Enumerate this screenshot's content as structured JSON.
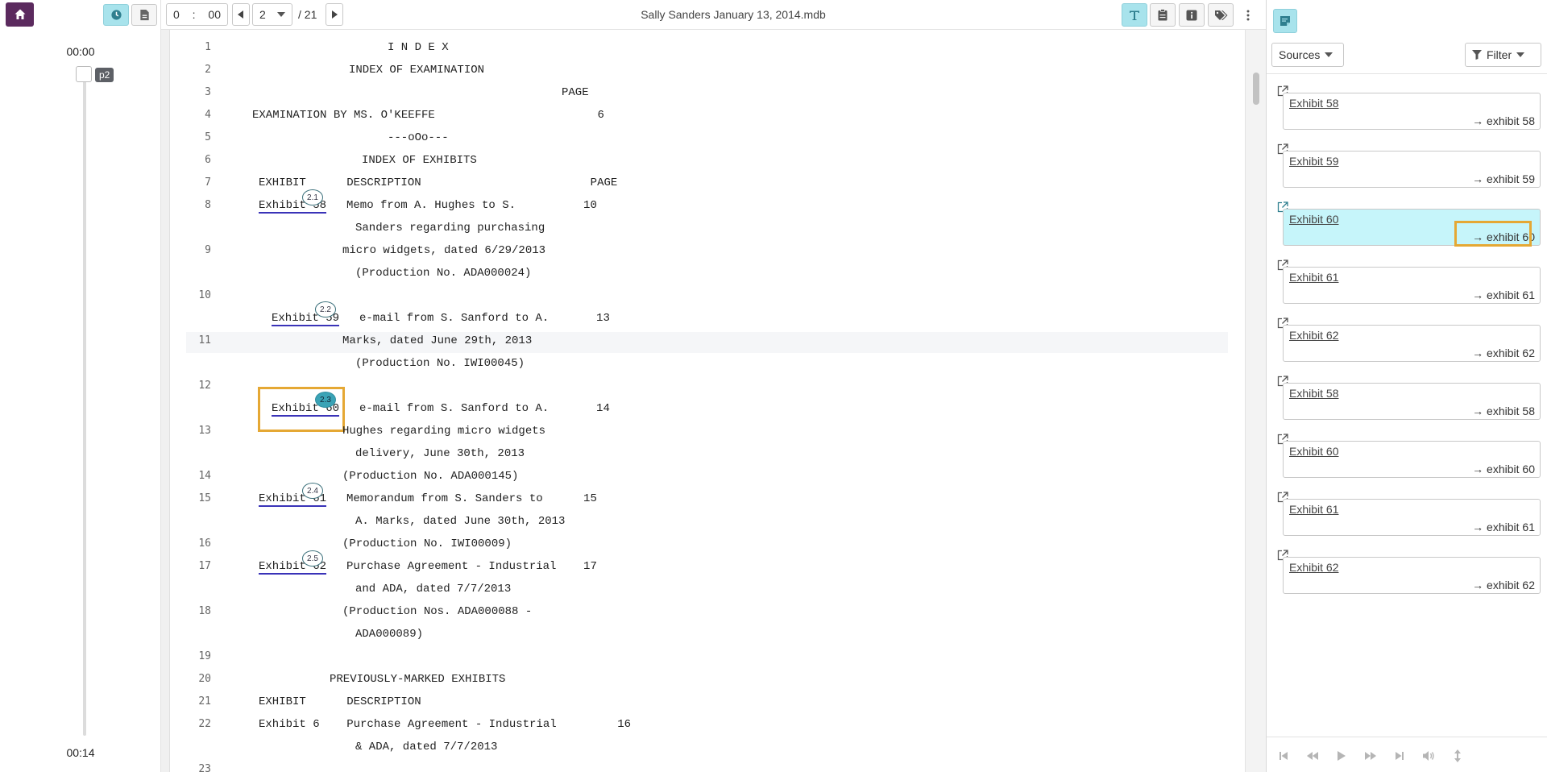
{
  "left": {
    "time_start": "00:00",
    "time_end": "00:14",
    "page_tag": "p2"
  },
  "toolbar": {
    "time_hours": "0",
    "time_sep": ":",
    "time_minutes": "00",
    "page_current": "2",
    "page_total": "/ 21",
    "doc_title": "Sally Sanders January 13, 2014.mdb"
  },
  "transcript": {
    "lines": [
      {
        "num": "1",
        "text": "I N D E X"
      },
      {
        "num": "2",
        "text": "INDEX OF EXAMINATION"
      },
      {
        "num": "3",
        "text": "PAGE"
      },
      {
        "num": "4",
        "text": "EXAMINATION BY MS. O'KEEFFE                        6"
      },
      {
        "num": "5",
        "text": "---oOo---"
      },
      {
        "num": "6",
        "text": "INDEX OF EXHIBITS"
      },
      {
        "num": "7",
        "text": "EXHIBIT      DESCRIPTION                         PAGE"
      },
      {
        "num": "8",
        "text": "Memo from A. Hughes to S.          10"
      },
      {
        "num": "",
        "text": "Sanders regarding purchasing"
      },
      {
        "num": "9",
        "text": "micro widgets, dated 6/29/2013"
      },
      {
        "num": "",
        "text": "(Production No. ADA000024)"
      },
      {
        "num": "10",
        "text": ""
      },
      {
        "num": "",
        "text": "e-mail from S. Sanford to A.       13"
      },
      {
        "num": "11",
        "text": "Marks, dated June 29th, 2013"
      },
      {
        "num": "",
        "text": "(Production No. IWI00045)"
      },
      {
        "num": "12",
        "text": ""
      },
      {
        "num": "",
        "text": "e-mail from S. Sanford to A.       14"
      },
      {
        "num": "13",
        "text": "Hughes regarding micro widgets"
      },
      {
        "num": "",
        "text": "delivery, June 30th, 2013"
      },
      {
        "num": "14",
        "text": "(Production No. ADA000145)"
      },
      {
        "num": "15",
        "text": "Memorandum from S. Sanders to      15"
      },
      {
        "num": "",
        "text": "A. Marks, dated June 30th, 2013"
      },
      {
        "num": "16",
        "text": "(Production No. IWI00009)"
      },
      {
        "num": "17",
        "text": "Purchase Agreement - Industrial    17"
      },
      {
        "num": "",
        "text": "and ADA, dated 7/7/2013"
      },
      {
        "num": "18",
        "text": "(Production Nos. ADA000088 -"
      },
      {
        "num": "",
        "text": "ADA000089)"
      },
      {
        "num": "19",
        "text": ""
      },
      {
        "num": "20",
        "text": "PREVIOUSLY-MARKED EXHIBITS"
      },
      {
        "num": "21",
        "text": "EXHIBIT      DESCRIPTION"
      },
      {
        "num": "22",
        "text": "Exhibit 6    Purchase Agreement - Industrial         16"
      },
      {
        "num": "",
        "text": "& ADA, dated 7/7/2013"
      },
      {
        "num": "23",
        "text": ""
      }
    ],
    "exhibit_links": [
      {
        "label": "Exhibit 58",
        "marker": "2.1"
      },
      {
        "label": "Exhibit 59",
        "marker": "2.2"
      },
      {
        "label": "Exhibit 60",
        "marker": "2.3"
      },
      {
        "label": "Exhibit 61",
        "marker": "2.4"
      },
      {
        "label": "Exhibit 62",
        "marker": "2.5"
      }
    ]
  },
  "right": {
    "sources_label": "Sources",
    "filter_label": "Filter",
    "refs": [
      {
        "title": "Exhibit 58",
        "target": "→ exhibit 58"
      },
      {
        "title": "Exhibit 59",
        "target": "→ exhibit 59"
      },
      {
        "title": "Exhibit 60",
        "target": "→ exhibit 60"
      },
      {
        "title": "Exhibit 61",
        "target": "→ exhibit 61"
      },
      {
        "title": "Exhibit 62",
        "target": "→ exhibit 62"
      },
      {
        "title": "Exhibit 58",
        "target": "→ exhibit 58"
      },
      {
        "title": "Exhibit 60",
        "target": "→ exhibit 60"
      },
      {
        "title": "Exhibit 61",
        "target": "→ exhibit 61"
      },
      {
        "title": "Exhibit 62",
        "target": "→ exhibit 62"
      }
    ]
  },
  "colors": {
    "brand": "#5b2a5e",
    "active_tool": "#a8e3ec",
    "link_underline": "#3a33b8",
    "focus_outline": "#e5a834",
    "active_marker": "#3aa3b6",
    "active_ref": "#c6f5fa"
  }
}
